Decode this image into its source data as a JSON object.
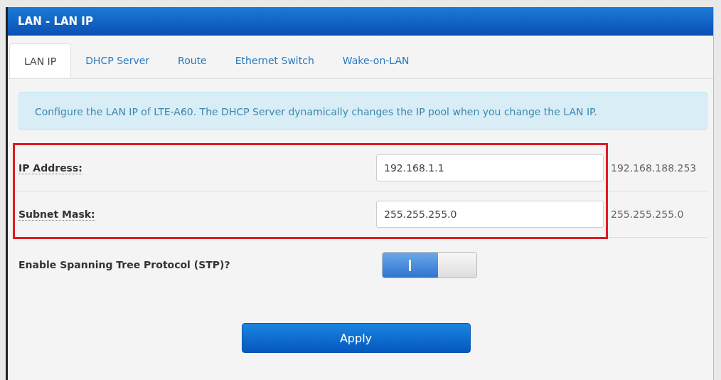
{
  "window": {
    "title": "LAN - LAN IP"
  },
  "tabs": [
    {
      "label": "LAN IP",
      "selected": true
    },
    {
      "label": "DHCP Server",
      "selected": false
    },
    {
      "label": "Route",
      "selected": false
    },
    {
      "label": "Ethernet Switch",
      "selected": false
    },
    {
      "label": "Wake-on-LAN",
      "selected": false
    }
  ],
  "info": "Configure the LAN IP of LTE-A60. The DHCP Server dynamically changes the IP pool when you change the LAN IP.",
  "fields": [
    {
      "label": "IP Address:",
      "value": "192.168.1.1",
      "hint": "192.168.188.253",
      "highlighted": true
    },
    {
      "label": "Subnet Mask:",
      "value": "255.255.255.0",
      "hint": "255.255.255.0",
      "highlighted": true
    }
  ],
  "stp": {
    "label": "Enable Spanning Tree Protocol (STP)?",
    "on": true
  },
  "apply_button": "Apply"
}
